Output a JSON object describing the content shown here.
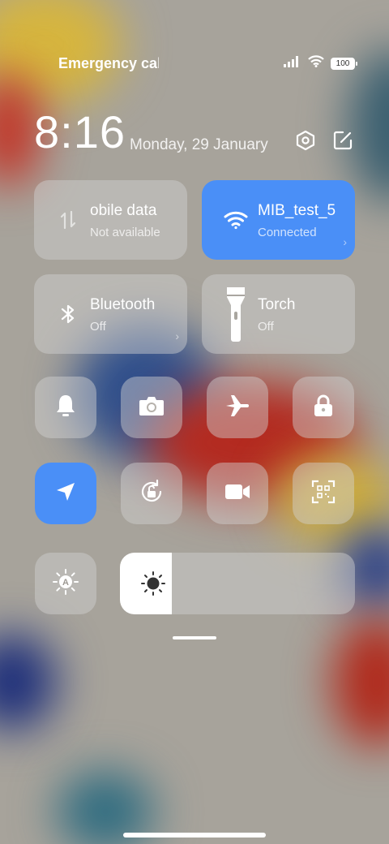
{
  "status_bar": {
    "carrier_text": "Emergency cal",
    "battery_level": "100",
    "icons": [
      "signal-icon",
      "wifi-icon",
      "battery-icon"
    ]
  },
  "header": {
    "time": "8:16",
    "date": "Monday, 29 January",
    "settings_icon": "hexagon-settings-icon",
    "edit_icon": "edit-icon"
  },
  "big_tiles": [
    {
      "id": "mobile-data",
      "title": "obile data",
      "subtitle": "Not available",
      "icon": "mobile-data-icon",
      "active": false
    },
    {
      "id": "wifi",
      "title": "MIB_test_5",
      "subtitle": "Connected",
      "icon": "wifi-icon",
      "active": true
    },
    {
      "id": "bluetooth",
      "title": "Bluetooth",
      "subtitle": "Off",
      "icon": "bluetooth-icon",
      "active": false
    },
    {
      "id": "torch",
      "title": "Torch",
      "subtitle": "Off",
      "icon": "torch-icon",
      "active": false
    }
  ],
  "small_tiles": [
    {
      "id": "sound",
      "icon": "bell-icon",
      "active": false
    },
    {
      "id": "screenshot",
      "icon": "camera-icon",
      "active": false
    },
    {
      "id": "airplane",
      "icon": "airplane-icon",
      "active": false
    },
    {
      "id": "lock",
      "icon": "lock-icon",
      "active": false
    },
    {
      "id": "location",
      "icon": "location-arrow-icon",
      "active": true
    },
    {
      "id": "auto-rotate",
      "icon": "rotation-lock-icon",
      "active": false
    },
    {
      "id": "screen-record",
      "icon": "video-camera-icon",
      "active": false
    },
    {
      "id": "scanner",
      "icon": "qr-scan-icon",
      "active": false
    }
  ],
  "brightness": {
    "auto_icon": "auto-brightness-icon",
    "slider_icon": "sun-icon",
    "level_fraction": 0.22
  },
  "colors": {
    "accent": "#4a8ff7",
    "tile_bg": "rgba(210,210,210,0.45)"
  }
}
